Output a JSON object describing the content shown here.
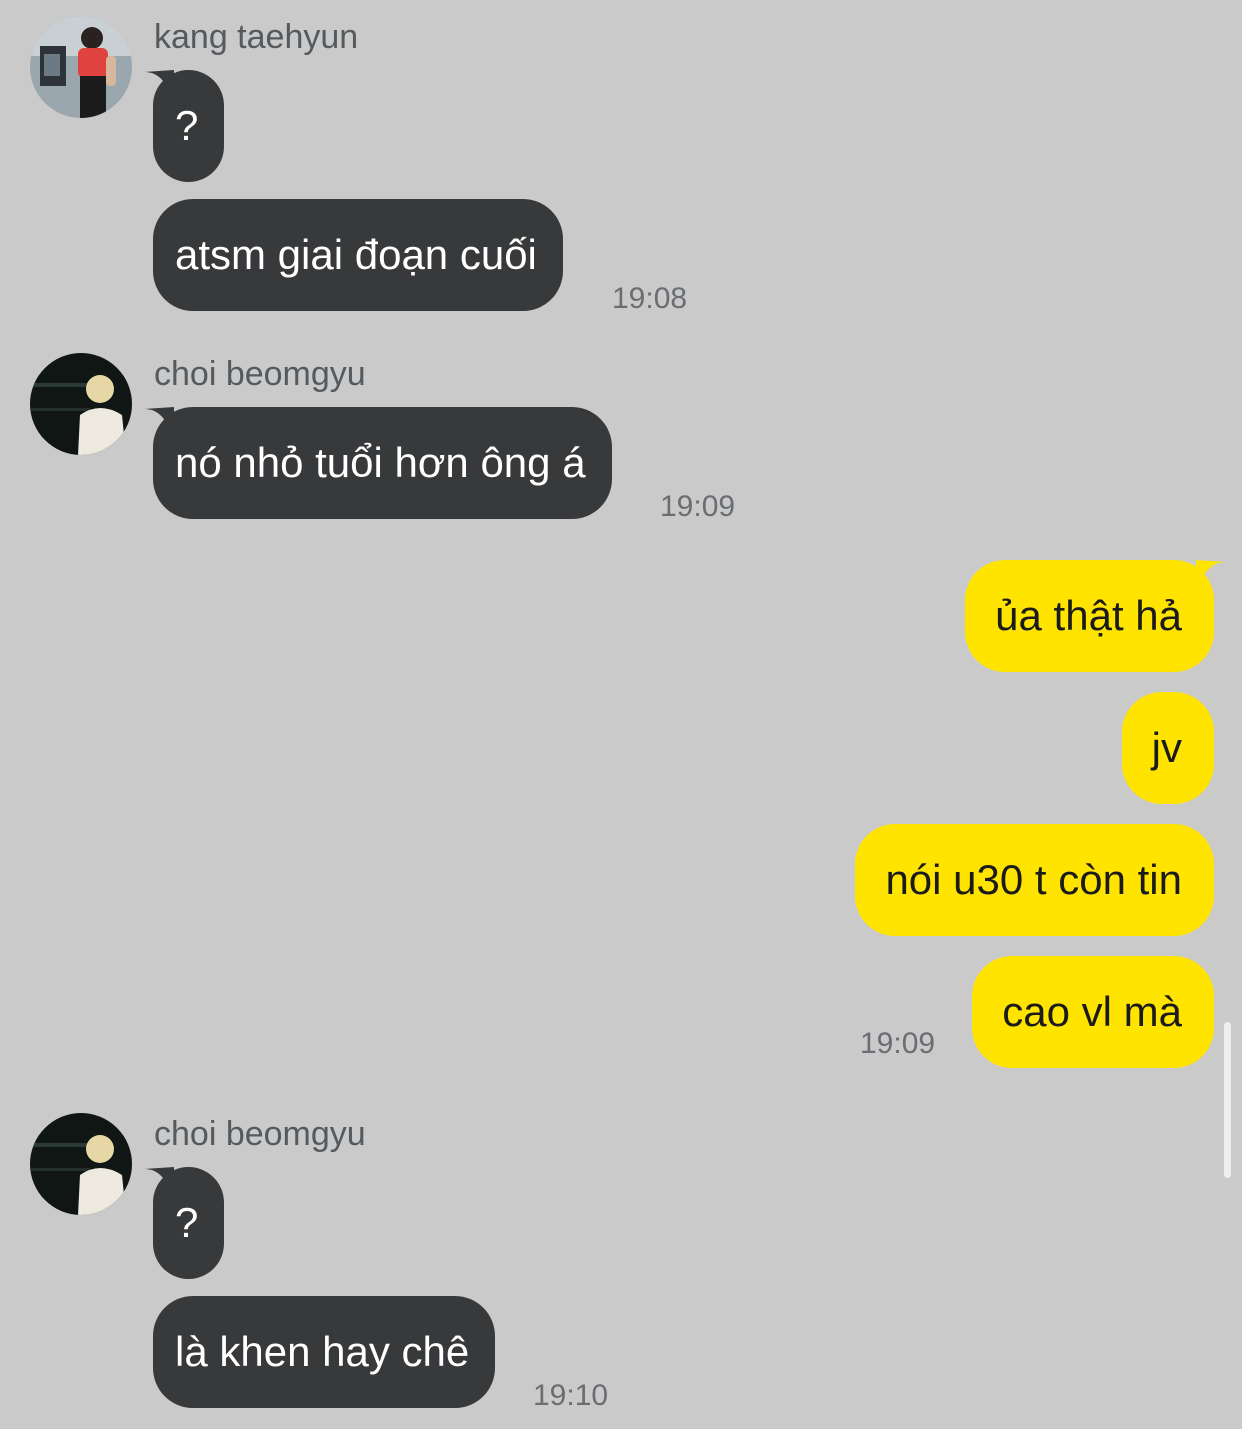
{
  "messages": [
    {
      "sender": "kang taehyun",
      "texts": [
        "?",
        "atsm giai đoạn cuối"
      ],
      "time": "19:08"
    },
    {
      "sender": "choi beomgyu",
      "texts": [
        "nó nhỏ tuổi hơn ông á"
      ],
      "time": "19:09"
    },
    {
      "sender": "me",
      "texts": [
        "ủa thật hả",
        "jv",
        "nói u30 t còn tin",
        "cao vl mà"
      ],
      "time": "19:09"
    },
    {
      "sender": "choi beomgyu",
      "texts": [
        "?",
        "là khen hay chê"
      ],
      "time": "19:10"
    }
  ],
  "colors": {
    "background": "#cacaca",
    "incoming_bubble": "#38393b",
    "outgoing_bubble": "#ffe400"
  },
  "icons": {
    "avatar_1": "avatar-kang-taehyun",
    "avatar_2": "avatar-choi-beomgyu"
  }
}
